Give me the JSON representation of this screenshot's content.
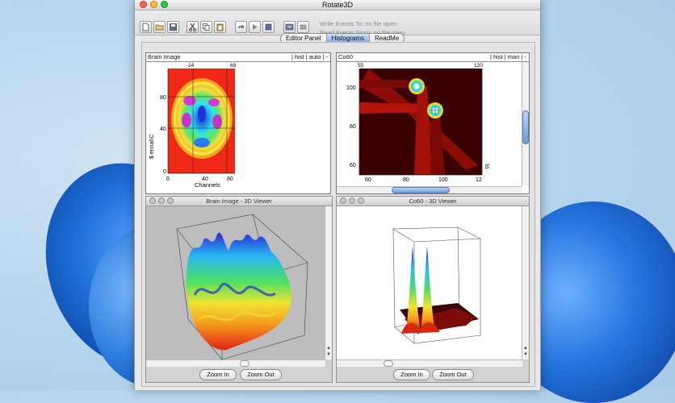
{
  "window": {
    "title": "Rotate3D"
  },
  "toolbar": {
    "write_events": "Write Events To: no file open",
    "read_events": "Read Events From: no file open"
  },
  "tabs": [
    {
      "label": "Editor Panel",
      "selected": false
    },
    {
      "label": "Histograms",
      "selected": true
    },
    {
      "label": "ReadMe",
      "selected": false
    }
  ],
  "hist_left": {
    "title": "Brain Image",
    "controls": "| hist  | auto | -",
    "top_ticks": [
      "24",
      "69"
    ],
    "yticks": [
      "80",
      "40",
      "0"
    ],
    "xticks": [
      "0",
      "40",
      "80"
    ],
    "xlabel": "Channels",
    "ylabel": "$ ennahC"
  },
  "hist_right": {
    "title": "Co60",
    "controls": "| hist  | man | -",
    "top_ticks": [
      "55",
      "120"
    ],
    "yticks": [
      "100",
      "80",
      "60"
    ],
    "xticks": [
      "60",
      "80",
      "100",
      "12"
    ],
    "right_tick": "55"
  },
  "viewer_left": {
    "title": "Brain Image - 3D Viewer",
    "zoom_in": "Zoom In",
    "zoom_out": "Zoom Out"
  },
  "viewer_right": {
    "title": "Co60 - 3D Viewer",
    "zoom_in": "Zoom In",
    "zoom_out": "Zoom Out"
  },
  "colors": {
    "brand_blue": "#1f6fd9",
    "window_bg": "#e8e8e8"
  }
}
